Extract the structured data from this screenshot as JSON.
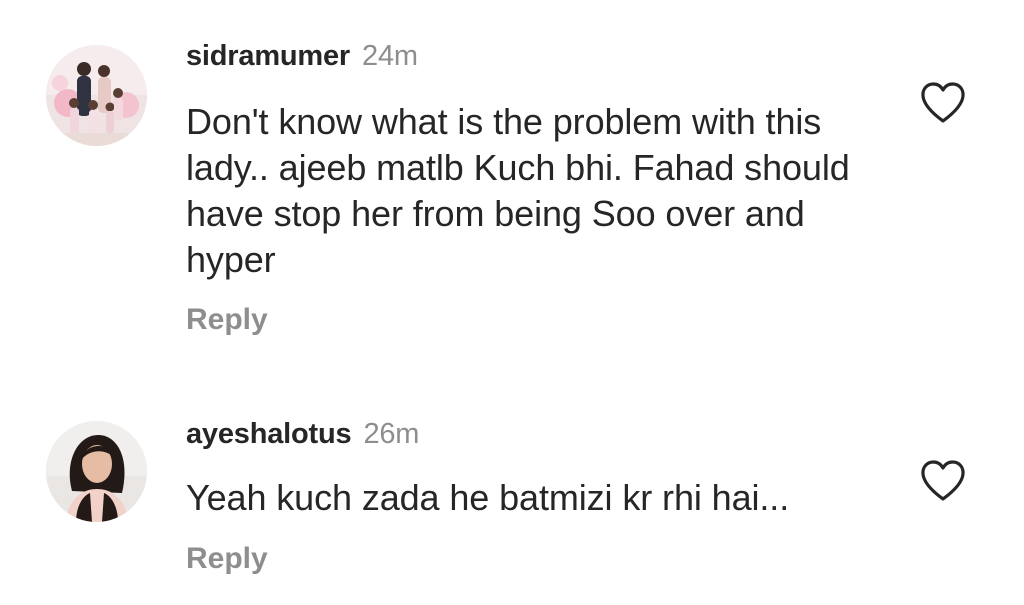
{
  "comments": [
    {
      "username": "sidramumer",
      "time": "24m",
      "text": "Don't know what is the problem with this lady.. ajeeb matlb Kuch bhi. Fahad should have stop her from being Soo over and hyper",
      "reply_label": "Reply",
      "like_icon": "heart-outline-icon",
      "avatar_desc": "family-photo-avatar"
    },
    {
      "username": "ayeshalotus",
      "time": "26m",
      "text": "Yeah kuch zada he batmizi kr rhi hai...",
      "reply_label": "Reply",
      "like_icon": "heart-outline-icon",
      "avatar_desc": "woman-portrait-avatar"
    }
  ]
}
